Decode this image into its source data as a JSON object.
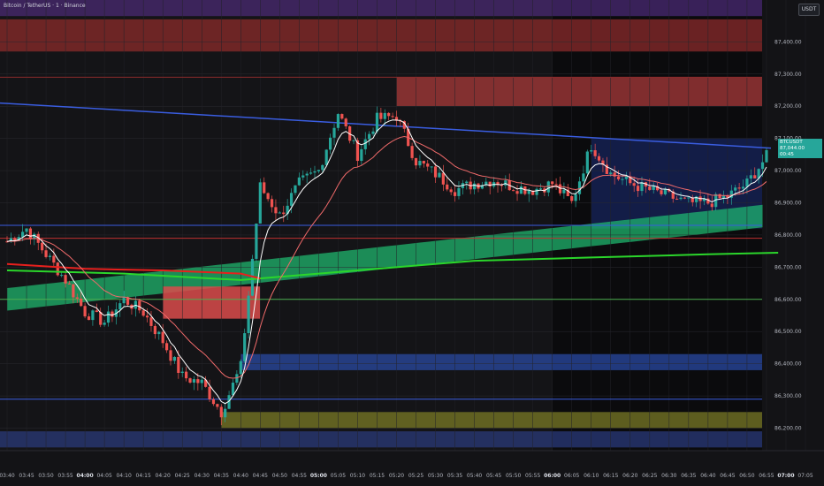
{
  "header": {
    "symbol_title": "Bitcoin / TetherUS · 1 · Binance",
    "currency_button": "USDT"
  },
  "price_tag": {
    "symbol": "BTCUSDT",
    "price": "87,044.00",
    "countdown": "00:45"
  },
  "colors": {
    "background": "#141417",
    "bull": "#26a69a",
    "bear": "#ef5350",
    "ema_slow": "#2bd62b",
    "ema_fast": "#ffffff",
    "ema_mid": "#f06a6a",
    "ma_red": "#e8201d",
    "trendline": "#3a5de0",
    "cloud_green": "#1fbf73",
    "cloud_red": "#d94b4b",
    "zone_red": "#8b2b2b",
    "zone_purple": "#4a2a73",
    "zone_blue": "#2a4aa3",
    "zone_olive": "#7a7a25",
    "axis_text": "#b2b5be"
  },
  "chart_data": {
    "type": "candlestick",
    "title": "Bitcoin / TetherUS · 1 · Binance",
    "ylim": [
      86130,
      87530
    ],
    "y_ticks": [
      87400,
      87300,
      87200,
      87100,
      87000,
      86900,
      86800,
      86700,
      86600,
      86500,
      86400,
      86300,
      86200
    ],
    "y_tick_labels": [
      "87,400.00",
      "87,300.00",
      "87,200.00",
      "87,100.00",
      "87,000.00",
      "86,900.00",
      "86,800.00",
      "86,700.00",
      "86,600.00",
      "86,500.00",
      "86,400.00",
      "86,300.00",
      "86,200.00"
    ],
    "x_start": "03:40",
    "x_end": "07:05",
    "x_ticks": [
      "03:40",
      "03:45",
      "03:50",
      "03:55",
      "04:00",
      "04:05",
      "04:10",
      "04:15",
      "04:20",
      "04:25",
      "04:30",
      "04:35",
      "04:40",
      "04:45",
      "04:50",
      "04:55",
      "05:00",
      "05:05",
      "05:10",
      "05:15",
      "05:20",
      "05:25",
      "05:30",
      "05:35",
      "05:40",
      "05:45",
      "05:50",
      "05:55",
      "06:00",
      "06:05",
      "06:10",
      "06:15",
      "06:20",
      "06:25",
      "06:30",
      "06:35",
      "06:40",
      "06:45",
      "06:50",
      "06:55",
      "07:00",
      "07:05"
    ],
    "bold_ticks": [
      "04:00",
      "05:00",
      "06:00",
      "07:00"
    ],
    "current_price": 87044,
    "price_anchors": [
      [
        "03:40",
        86780
      ],
      [
        "03:45",
        86820
      ],
      [
        "03:50",
        86740
      ],
      [
        "03:55",
        86660
      ],
      [
        "04:00",
        86560
      ],
      [
        "04:05",
        86530
      ],
      [
        "04:10",
        86600
      ],
      [
        "04:15",
        86560
      ],
      [
        "04:20",
        86470
      ],
      [
        "04:25",
        86360
      ],
      [
        "04:30",
        86340
      ],
      [
        "04:35",
        86250
      ],
      [
        "04:40",
        86390
      ],
      [
        "04:45",
        86950
      ],
      [
        "04:50",
        86860
      ],
      [
        "04:55",
        86960
      ],
      [
        "05:00",
        87000
      ],
      [
        "05:05",
        87180
      ],
      [
        "05:10",
        87050
      ],
      [
        "05:15",
        87160
      ],
      [
        "05:20",
        87170
      ],
      [
        "05:25",
        87030
      ],
      [
        "05:30",
        86990
      ],
      [
        "05:35",
        86940
      ],
      [
        "05:40",
        86960
      ],
      [
        "05:45",
        86970
      ],
      [
        "05:50",
        86950
      ],
      [
        "05:55",
        86940
      ],
      [
        "06:00",
        86960
      ],
      [
        "06:05",
        86900
      ],
      [
        "06:10",
        87080
      ],
      [
        "06:15",
        86990
      ],
      [
        "06:20",
        86960
      ],
      [
        "06:25",
        86940
      ],
      [
        "06:30",
        86920
      ],
      [
        "06:35",
        86900
      ],
      [
        "06:40",
        86900
      ],
      [
        "06:45",
        86920
      ],
      [
        "06:50",
        86960
      ],
      [
        "06:55",
        87044
      ]
    ],
    "ema_200_series": [
      [
        "03:40",
        86690
      ],
      [
        "04:10",
        86680
      ],
      [
        "04:40",
        86660
      ],
      [
        "05:10",
        86690
      ],
      [
        "05:40",
        86720
      ],
      [
        "06:10",
        86730
      ],
      [
        "06:40",
        86740
      ],
      [
        "06:58",
        86745
      ]
    ],
    "ma_red_series": [
      [
        "03:40",
        86710
      ],
      [
        "04:00",
        86695
      ],
      [
        "04:20",
        86690
      ],
      [
        "04:40",
        86680
      ],
      [
        "04:45",
        86665
      ]
    ],
    "horizontal_levels": [
      {
        "price": 87290,
        "color": "#8b2b2b"
      },
      {
        "price": 86790,
        "color": "#c03030"
      },
      {
        "price": 86600,
        "color": "#4caf50"
      },
      {
        "price": 86830,
        "color": "#3a5de0"
      },
      {
        "price": 86290,
        "color": "#3a5de0"
      }
    ],
    "zones": [
      {
        "name": "purple-top",
        "from": 87480,
        "to": 87530,
        "color": "#4a2a73"
      },
      {
        "name": "supply-top",
        "from": 87370,
        "to": 87470,
        "color": "#8b2b2b"
      },
      {
        "name": "supply-mid",
        "from": 87200,
        "to": 87290,
        "color": "#a83a3a",
        "start": "05:20"
      },
      {
        "name": "demand-blue",
        "from": 86380,
        "to": 86430,
        "color": "#2a4aa3",
        "start": "04:40"
      },
      {
        "name": "olive-low",
        "from": 86200,
        "to": 86250,
        "color": "#7a7a25",
        "start": "04:35"
      },
      {
        "name": "blue-bottom",
        "from": 86140,
        "to": 86190,
        "color": "#2a3a7a"
      }
    ],
    "grid": true,
    "legend": "none"
  }
}
